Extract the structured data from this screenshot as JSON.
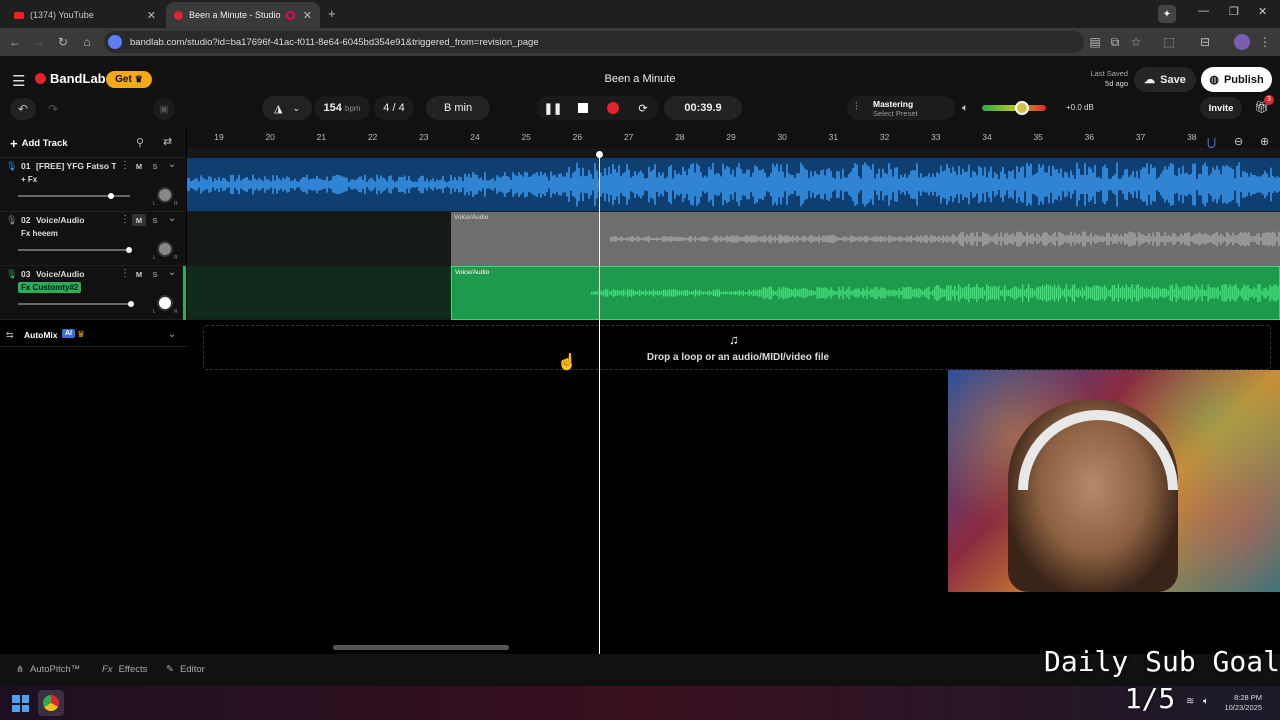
{
  "browser": {
    "tabs": [
      {
        "title": "(1374) YouTube"
      },
      {
        "title": "Been a Minute - Studio"
      }
    ],
    "url": "bandlab.com/studio?id=ba17696f-41ac-f011-8e64-6045bd354e91&triggered_from=revision_page"
  },
  "app": {
    "brand": "BandLab",
    "get_label": "Get",
    "project_title": "Been a Minute",
    "last_saved_label": "Last Saved",
    "last_saved_value": "5d ago",
    "save_label": "Save",
    "publish_label": "Publish",
    "invite_label": "Invite",
    "gift_badge": "3"
  },
  "transport": {
    "bpm_value": "154",
    "bpm_unit": "bpm",
    "time_signature": "4 / 4",
    "key": "B min",
    "time": "00:39.9",
    "mastering_label": "Mastering",
    "mastering_preset": "Select Preset",
    "volume_db": "+0.0 dB",
    "volume_level": 0.62
  },
  "toolbar": {
    "add_track_label": "Add Track"
  },
  "ruler": {
    "bars": [
      "19",
      "20",
      "21",
      "22",
      "23",
      "24",
      "25",
      "26",
      "27",
      "28",
      "29",
      "30",
      "31",
      "32",
      "33",
      "34",
      "35",
      "36",
      "37",
      "38"
    ]
  },
  "tracks": [
    {
      "number": "01",
      "name": "[FREE] YFG Fatso T...",
      "fx": "+ Fx",
      "mute": "M",
      "solo": "S",
      "volume_level": 0.82,
      "color": "#2f8fe8"
    },
    {
      "number": "02",
      "name": "Voice/Audio",
      "fx": "Fx heeem",
      "mute": "M",
      "solo": "S",
      "volume_level": 0.98,
      "color": "#8a8a8a"
    },
    {
      "number": "03",
      "name": "Voice/Audio",
      "fx": "Fx Customty#2",
      "mute": "M",
      "solo": "S",
      "volume_level": 1.0,
      "color": "#26b05a"
    }
  ],
  "regions": {
    "track2_label": "Voice/Audio",
    "track3_label": "Voice/Audio"
  },
  "automix": {
    "label": "AutoMix",
    "ai_badge": "AI"
  },
  "dropzone": {
    "text": "Drop a loop or an audio/MIDI/video file"
  },
  "bottom": {
    "autopitch": "AutoPitch™",
    "effects": "Effects",
    "editor": "Editor"
  },
  "overlay": {
    "sub_goal_title": "Daily Sub Goal",
    "sub_goal_progress": "1/5"
  },
  "taskbar": {
    "time": "8:28 PM",
    "date": "10/23/2025"
  },
  "colors": {
    "accent_orange": "#f2a818",
    "record_red": "#e0242b",
    "track1_blue": "#2f8fe8",
    "track3_green": "#26b05a",
    "playhead": "#ffffff"
  }
}
